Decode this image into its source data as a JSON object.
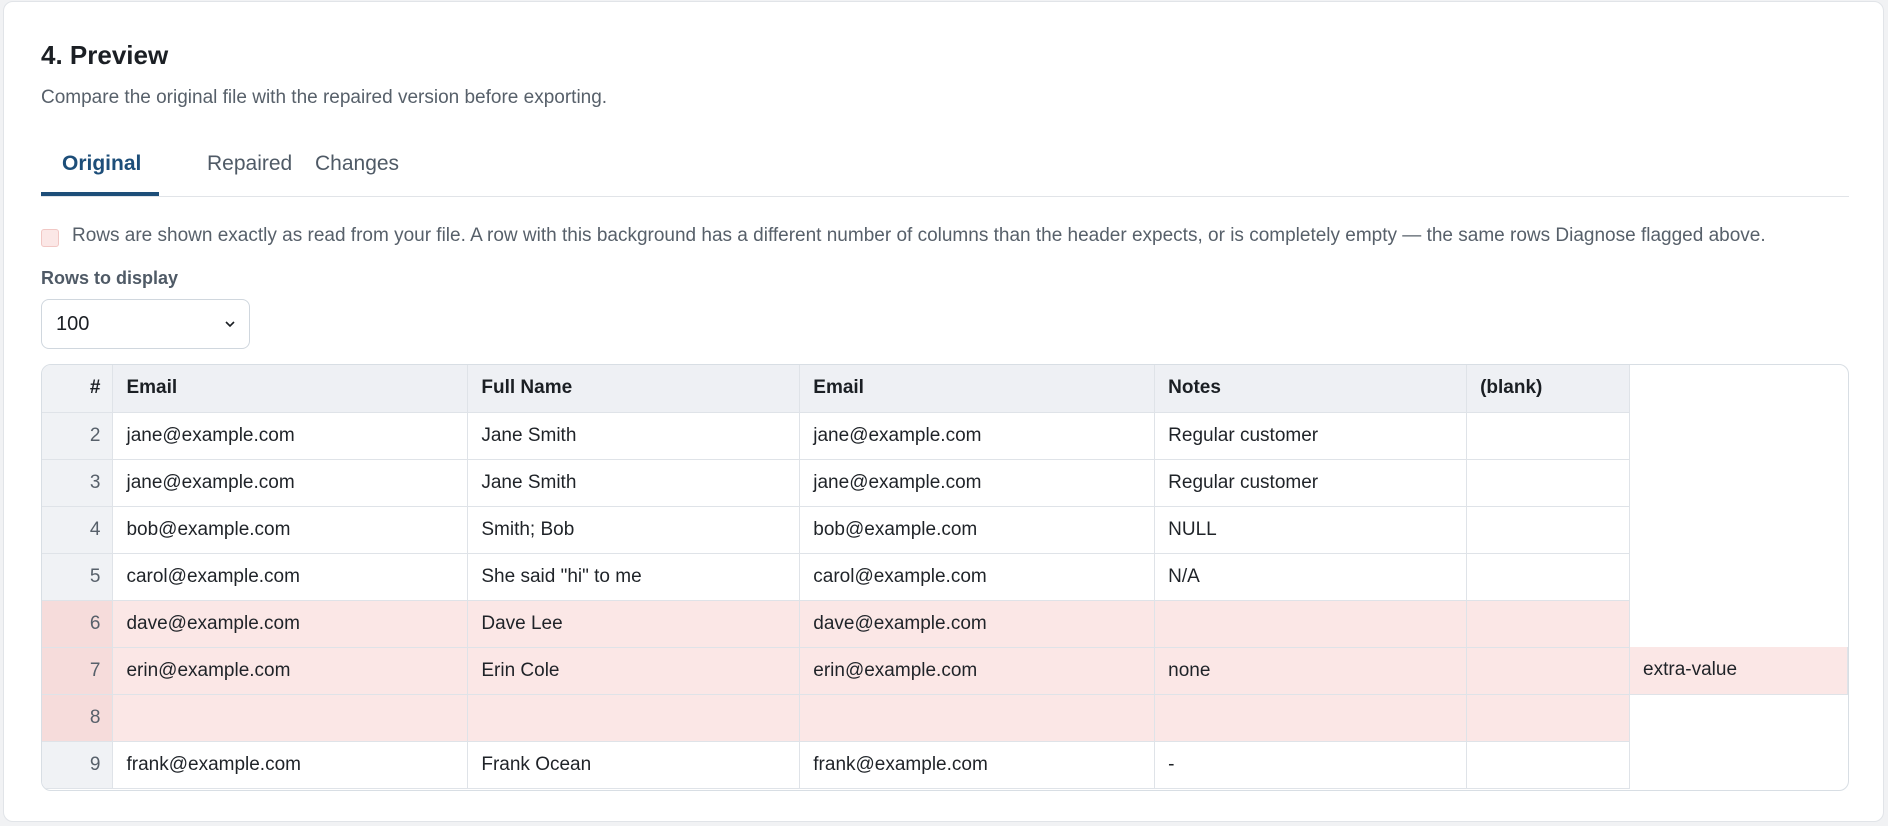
{
  "section": {
    "title": "4. Preview",
    "subtitle": "Compare the original file with the repaired version before exporting."
  },
  "tabs": [
    {
      "label": "Original",
      "active": true
    },
    {
      "label": "Repaired",
      "active": false
    },
    {
      "label": "Changes",
      "active": false
    }
  ],
  "legend": {
    "text": "Rows are shown exactly as read from your file. A row with this background has a different number of columns than the header expects, or is completely empty — the same rows Diagnose flagged above.",
    "flag_color": "#fbe7e6"
  },
  "rows_control": {
    "label": "Rows to display",
    "value": "100"
  },
  "table": {
    "columns": [
      "#",
      "Email",
      "Full Name",
      "Email",
      "Notes",
      "(blank)"
    ],
    "rows": [
      {
        "n": "2",
        "cells": [
          "jane@example.com",
          "Jane Smith",
          "jane@example.com",
          "Regular customer",
          ""
        ],
        "extra": null,
        "flagged": false
      },
      {
        "n": "3",
        "cells": [
          "jane@example.com",
          "Jane Smith",
          "jane@example.com",
          "Regular customer",
          ""
        ],
        "extra": null,
        "flagged": false
      },
      {
        "n": "4",
        "cells": [
          "bob@example.com",
          "Smith; Bob",
          "bob@example.com",
          "NULL",
          ""
        ],
        "extra": null,
        "flagged": false
      },
      {
        "n": "5",
        "cells": [
          "carol@example.com",
          "She said \"hi\" to me",
          "carol@example.com",
          "N/A",
          ""
        ],
        "extra": null,
        "flagged": false
      },
      {
        "n": "6",
        "cells": [
          "dave@example.com",
          "Dave Lee",
          "dave@example.com",
          "",
          ""
        ],
        "extra": null,
        "flagged": true
      },
      {
        "n": "7",
        "cells": [
          "erin@example.com",
          "Erin Cole",
          "erin@example.com",
          "none",
          ""
        ],
        "extra": "extra-value",
        "flagged": true
      },
      {
        "n": "8",
        "cells": [
          "",
          "",
          "",
          "",
          ""
        ],
        "extra": null,
        "flagged": true
      },
      {
        "n": "9",
        "cells": [
          "frank@example.com",
          "Frank Ocean",
          "frank@example.com",
          "-",
          ""
        ],
        "extra": null,
        "flagged": false
      }
    ]
  }
}
